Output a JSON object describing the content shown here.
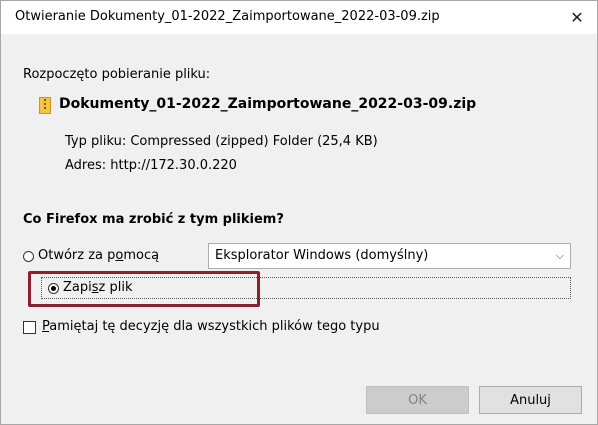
{
  "window": {
    "title": "Otwieranie Dokumenty_01-2022_Zaimportowane_2022-03-09.zip",
    "close_glyph": "✕"
  },
  "dialog": {
    "lead_text": "Rozpoczęto pobieranie pliku:",
    "file_name": "Dokumenty_01-2022_Zaimportowane_2022-03-09.zip",
    "file_icon": "zip-folder-icon",
    "type_label": "Typ pliku:",
    "type_value": "Compressed (zipped) Folder (25,4 KB)",
    "address_label": "Adres:",
    "address_value": "http://172.30.0.220",
    "question": "Co Firefox ma zrobić z tym plikiem?"
  },
  "options": {
    "open_with": {
      "label_before": "Otwórz za p",
      "label_accel": "o",
      "label_after": "mocą",
      "selected": false,
      "app_select_value": "Eksplorator Windows (domyślny)"
    },
    "save": {
      "label_before": "Zapi",
      "label_accel": "s",
      "label_after": "z plik",
      "selected": true
    },
    "remember": {
      "label_accel": "P",
      "label_after": "amiętaj tę decyzję dla wszystkich plików tego typu",
      "checked": false
    }
  },
  "buttons": {
    "ok_label": "OK",
    "cancel_label": "Anuluj"
  },
  "colors": {
    "highlight_box": "#8b2130",
    "dialog_bg": "#f0f0f0"
  }
}
